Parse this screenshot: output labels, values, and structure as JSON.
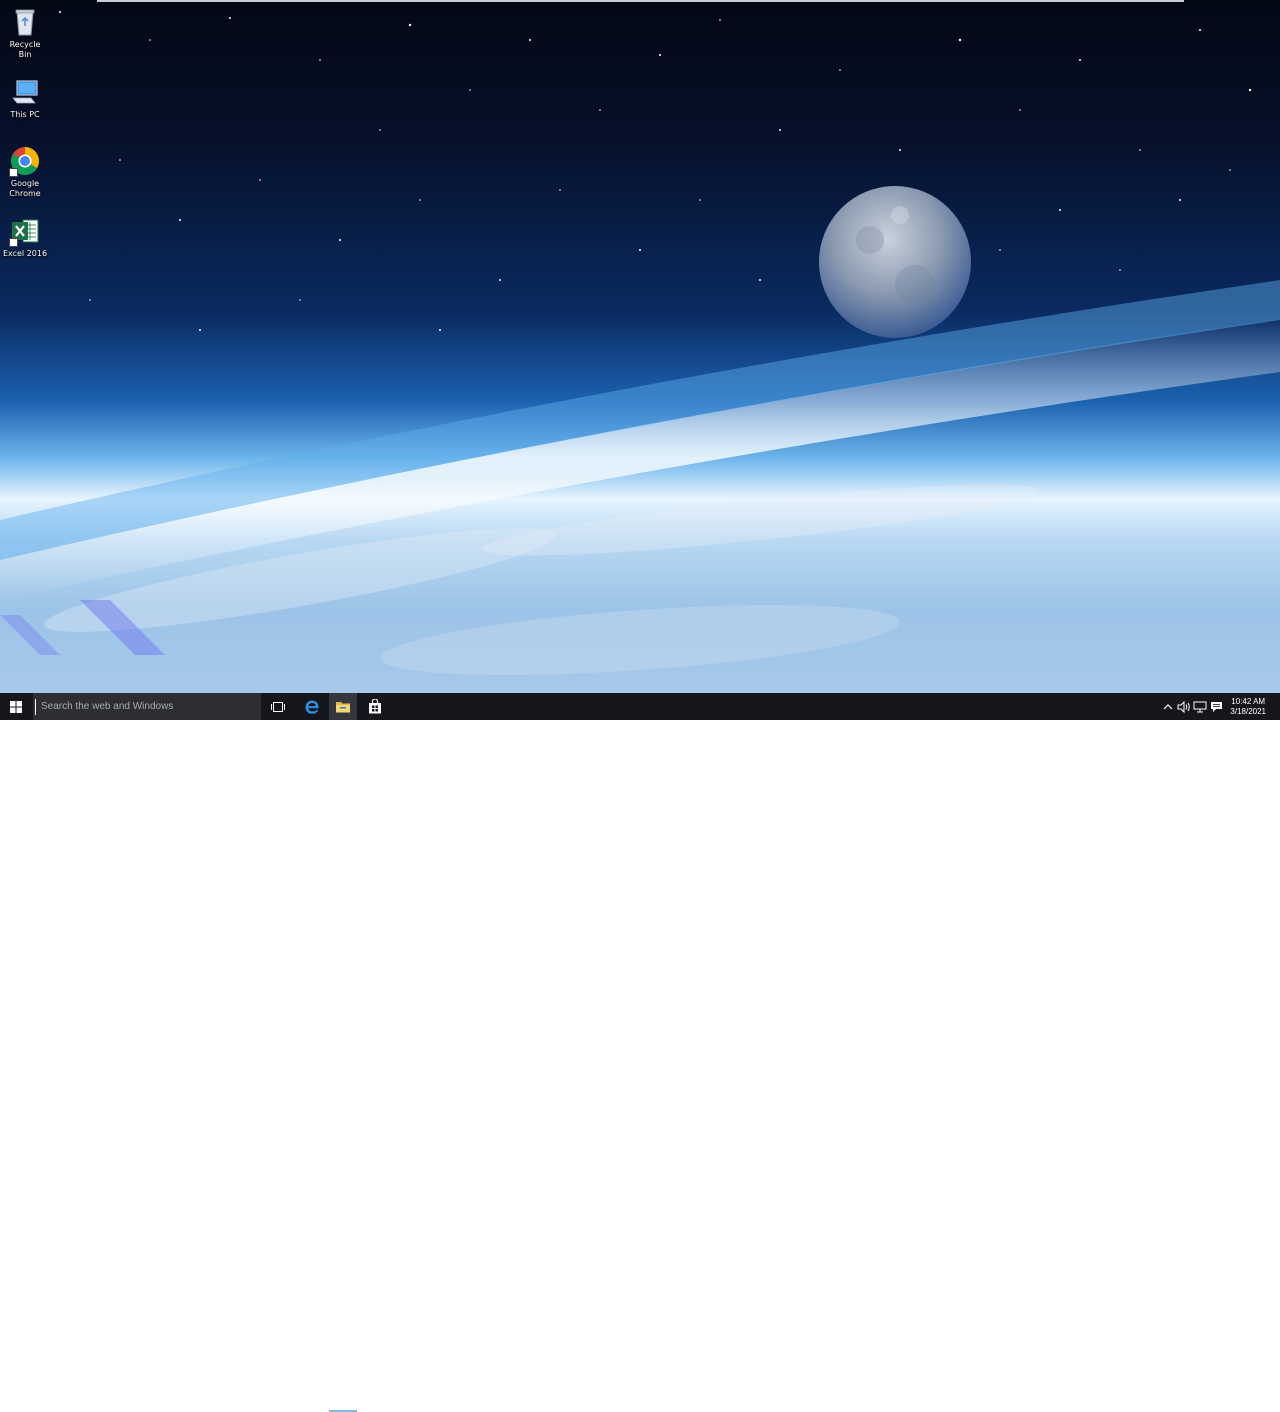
{
  "desktop": {
    "icons": [
      {
        "label": "Recycle Bin"
      },
      {
        "label": "This PC"
      },
      {
        "label": "Google Chrome"
      },
      {
        "label": "Excel 2016"
      }
    ]
  },
  "taskbar": {
    "search_placeholder": "Search the web and Windows",
    "pinned_apps": [
      "task-view",
      "microsoft-edge",
      "file-explorer",
      "windows-store"
    ],
    "active_app": "file-explorer",
    "tray_icons": [
      "chevron-up-icon",
      "volume-icon",
      "network-icon",
      "action-center-icon"
    ],
    "clock": {
      "time": "10:42 AM",
      "date": "3/18/2021"
    }
  },
  "colors": {
    "taskbar_bg": "#15171c",
    "search_bg": "#2c2e33",
    "accent": "#0078d7"
  }
}
